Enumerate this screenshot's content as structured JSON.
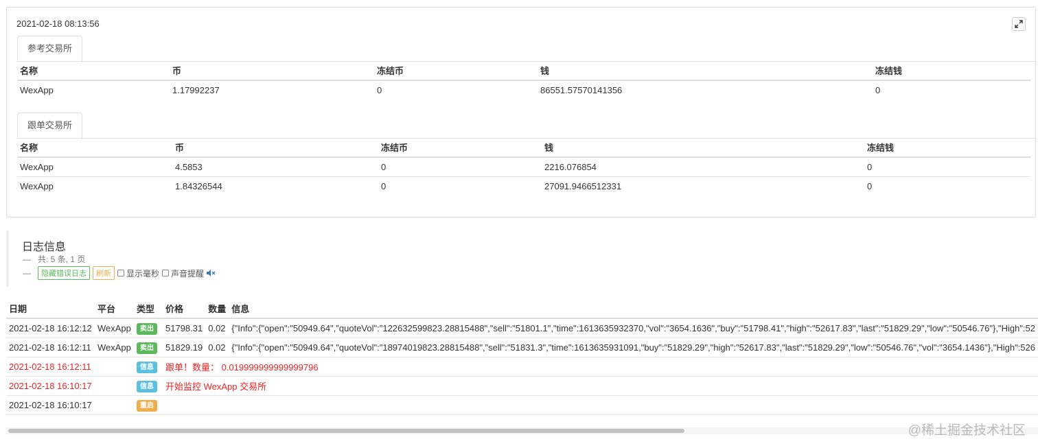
{
  "status": {
    "timestamp": "2021-02-18 08:13:56",
    "expand_icon": "expand-icon"
  },
  "reference_exchange": {
    "tab_label": "参考交易所",
    "columns": [
      "名称",
      "币",
      "冻结币",
      "钱",
      "冻结钱"
    ],
    "rows": [
      [
        "WexApp",
        "1.17992237",
        "0",
        "86551.57570141356",
        "0"
      ]
    ]
  },
  "follow_exchange": {
    "tab_label": "跟单交易所",
    "columns": [
      "名称",
      "币",
      "冻结币",
      "钱",
      "冻结钱"
    ],
    "rows": [
      [
        "WexApp",
        "4.5853",
        "0",
        "2216.076854",
        "0"
      ],
      [
        "WexApp",
        "1.84326544",
        "0",
        "27091.9466512331",
        "0"
      ]
    ]
  },
  "log": {
    "title": "日志信息",
    "summary": "共: 5 条, 1 页",
    "hide_error_button": "隐藏错误日志",
    "refresh_button": "刷新",
    "show_ms_label": "显示毫秒",
    "sound_alert_label": "声音提醒",
    "mute_icon": "speaker-muted-icon",
    "columns": [
      "日期",
      "平台",
      "类型",
      "价格",
      "数量",
      "信息"
    ],
    "rows": [
      {
        "date": "2021-02-18 16:12:12",
        "platform": "WexApp",
        "type": "卖出",
        "badge": "sell",
        "price": "51798.31",
        "amount": "0.02",
        "info": "{\"Info\":{\"open\":\"50949.64\",\"quoteVol\":\"122632599823.28815488\",\"sell\":\"51801.1\",\"time\":1613635932370,\"vol\":\"3654.1636\",\"buy\":\"51798.41\",\"high\":\"52617.83\",\"last\":\"51829.29\",\"low\":\"50546.76\"},\"High\":52",
        "red": false
      },
      {
        "date": "2021-02-18 16:12:11",
        "platform": "WexApp",
        "type": "卖出",
        "badge": "sell",
        "price": "51829.19",
        "amount": "0.02",
        "info": "{\"Info\":{\"open\":\"50949.64\",\"quoteVol\":\"18974019823.28815488\",\"sell\":\"51831.3\",\"time\":1613635931091,\"buy\":\"51829.29\",\"high\":\"52617.83\",\"last\":\"51829.29\",\"low\":\"50546.76\",\"vol\":\"3654.1436\"},\"High\":526",
        "red": false
      },
      {
        "date": "2021-02-18 16:12:11",
        "platform": "",
        "type": "信息",
        "badge": "info",
        "price": "",
        "amount": "",
        "info": "跟单！数量： 0.019999999999999796",
        "red": true
      },
      {
        "date": "2021-02-18 16:10:17",
        "platform": "",
        "type": "信息",
        "badge": "info",
        "price": "",
        "amount": "",
        "info": "开始监控 WexApp 交易所",
        "red": true
      },
      {
        "date": "2021-02-18 16:10:17",
        "platform": "",
        "type": "重启",
        "badge": "restart",
        "price": "",
        "amount": "",
        "info": "",
        "red": false
      }
    ]
  },
  "scroll": {
    "position_fraction": 0.0,
    "visible_fraction": 0.66
  },
  "watermark": "@稀土掘金技术社区"
}
